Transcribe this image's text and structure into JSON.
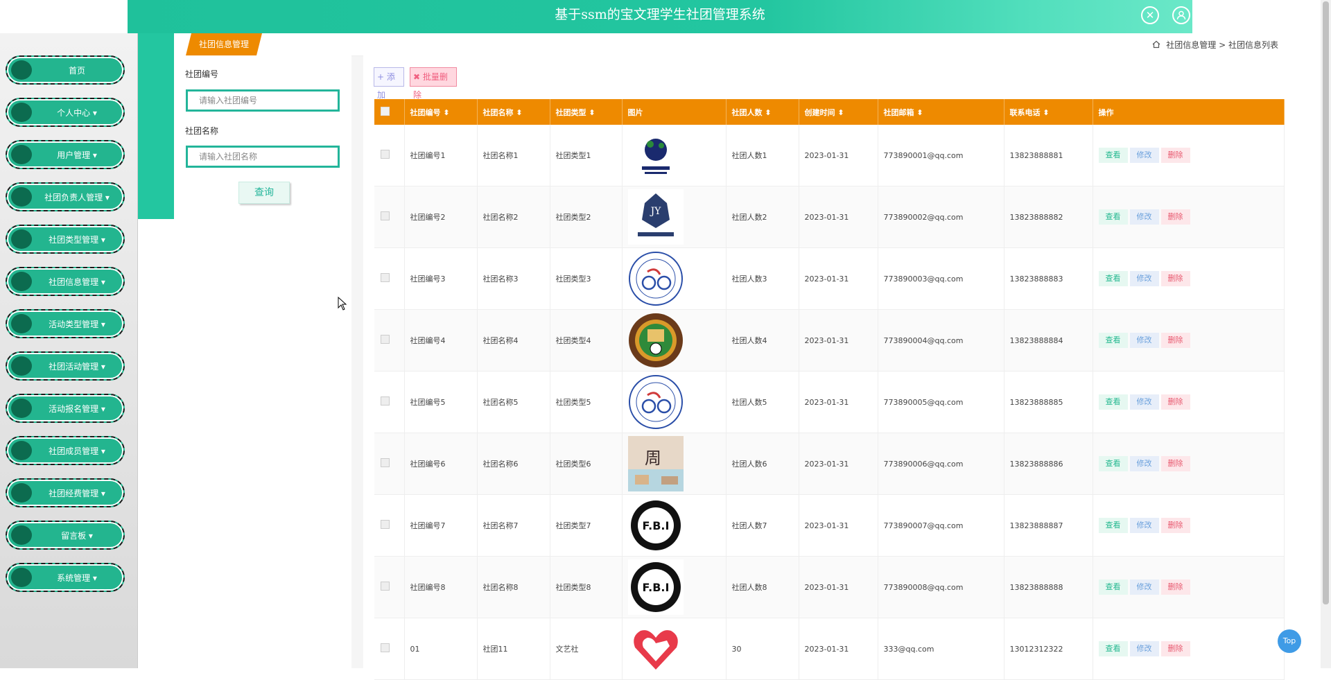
{
  "header": {
    "title": "基于ssm的宝文理学生社团管理系统",
    "close_icon": "close-icon",
    "user_icon": "user-icon"
  },
  "sidebar": {
    "items": [
      {
        "label": "首页"
      },
      {
        "label": "个人中心 ▾"
      },
      {
        "label": "用户管理 ▾"
      },
      {
        "label": "社团负责人管理 ▾"
      },
      {
        "label": "社团类型管理 ▾"
      },
      {
        "label": "社团信息管理 ▾"
      },
      {
        "label": "活动类型管理 ▾"
      },
      {
        "label": "社团活动管理 ▾"
      },
      {
        "label": "活动报名管理 ▾"
      },
      {
        "label": "社团成员管理 ▾"
      },
      {
        "label": "社团经费管理 ▾"
      },
      {
        "label": "留言板 ▾"
      },
      {
        "label": "系统管理 ▾"
      }
    ]
  },
  "tab": {
    "active": "社团信息管理"
  },
  "breadcrumb": {
    "level1": "社团信息管理",
    "sep": ">",
    "level2": "社团信息列表"
  },
  "search": {
    "id_label": "社团编号",
    "id_placeholder": "请输入社团编号",
    "name_label": "社团名称",
    "name_placeholder": "请输入社团名称",
    "query_label": "查询"
  },
  "toolbar": {
    "add_label": "+ 添加",
    "batch_delete_label": "✖ 批量删除"
  },
  "table": {
    "columns": [
      "社团编号 ⬍",
      "社团名称 ⬍",
      "社团类型 ⬍",
      "图片",
      "社团人数 ⬍",
      "创建时间 ⬍",
      "社团邮箱 ⬍",
      "联系电话 ⬍",
      "操作"
    ],
    "actions": {
      "view": "查看",
      "edit": "修改",
      "delete": "删除"
    },
    "rows": [
      {
        "id": "社团编号1",
        "name": "社团名称1",
        "type": "社团类型1",
        "logo": "basketball-club-logo",
        "count": "社团人数1",
        "date": "2023-01-31",
        "email": "773890001@qq.com",
        "phone": "13823888881"
      },
      {
        "id": "社团编号2",
        "name": "社团名称2",
        "type": "社团类型2",
        "logo": "jy-eagle-logo",
        "count": "社团人数2",
        "date": "2023-01-31",
        "email": "773890002@qq.com",
        "phone": "13823888882"
      },
      {
        "id": "社团编号3",
        "name": "社团名称3",
        "type": "社团类型3",
        "logo": "cycling-club-logo",
        "count": "社团人数3",
        "date": "2023-01-31",
        "email": "773890003@qq.com",
        "phone": "13823888883"
      },
      {
        "id": "社团编号4",
        "name": "社团名称4",
        "type": "社团类型4",
        "logo": "football-club-logo",
        "count": "社团人数4",
        "date": "2023-01-31",
        "email": "773890004@qq.com",
        "phone": "13823888884"
      },
      {
        "id": "社团编号5",
        "name": "社团名称5",
        "type": "社团类型5",
        "logo": "cycling-club-logo",
        "count": "社团人数5",
        "date": "2023-01-31",
        "email": "773890005@qq.com",
        "phone": "13823888885"
      },
      {
        "id": "社团编号6",
        "name": "社团名称6",
        "type": "社团类型6",
        "logo": "calligraphy-photo",
        "count": "社团人数6",
        "date": "2023-01-31",
        "email": "773890006@qq.com",
        "phone": "13823888886"
      },
      {
        "id": "社团编号7",
        "name": "社团名称7",
        "type": "社团类型7",
        "logo": "fbi-logo",
        "count": "社团人数7",
        "date": "2023-01-31",
        "email": "773890007@qq.com",
        "phone": "13823888887"
      },
      {
        "id": "社团编号8",
        "name": "社团名称8",
        "type": "社团类型8",
        "logo": "fbi-logo",
        "count": "社团人数8",
        "date": "2023-01-31",
        "email": "773890008@qq.com",
        "phone": "13823888888"
      },
      {
        "id": "01",
        "name": "社团11",
        "type": "文艺社",
        "logo": "heart-hand-logo",
        "count": "30",
        "date": "2023-01-31",
        "email": "333@qq.com",
        "phone": "13012312322"
      }
    ]
  },
  "top_button": "Top",
  "colors": {
    "accent": "#23c6a0",
    "table_header": "#ee8a00"
  }
}
